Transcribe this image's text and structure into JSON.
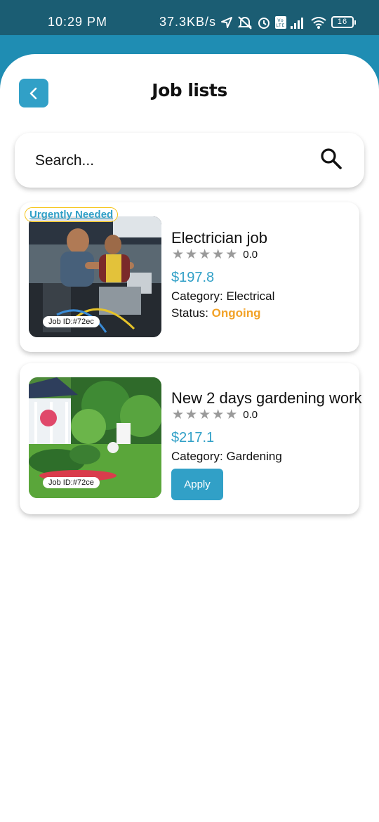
{
  "status_bar": {
    "time": "10:29 PM",
    "network_speed": "37.3KB/s",
    "battery": "16",
    "icons": [
      "location-arrow-icon",
      "mute-icon",
      "alarm-icon",
      "volte-icon",
      "signal-icon",
      "wifi-icon",
      "battery-icon"
    ]
  },
  "header": {
    "title": "Job lists",
    "back_icon": "chevron-left-icon"
  },
  "search": {
    "placeholder": "Search...",
    "icon": "search-icon"
  },
  "jobs": [
    {
      "badge": "Urgently Needed",
      "job_id": "Job ID:#72ec",
      "title": "Electrician job",
      "rating": "0.0",
      "stars": 0,
      "price": "$197.8",
      "category_label": "Category: ",
      "category": "Electrical",
      "status_label": "Status: ",
      "status": "Ongoing",
      "image": "electricians-working-photo"
    },
    {
      "job_id": "Job ID:#72ce",
      "title": "New 2 days gardening work",
      "rating": "0.0",
      "stars": 0,
      "price": "$217.1",
      "category_label": "Category: ",
      "category": "Gardening",
      "action": "Apply",
      "image": "garden-photo"
    }
  ],
  "colors": {
    "accent": "#31a0c7",
    "status_bar": "#1b5d73",
    "header_band": "#1f8db3",
    "status_ongoing": "#f2a227",
    "star_empty": "#9a9a9a"
  }
}
